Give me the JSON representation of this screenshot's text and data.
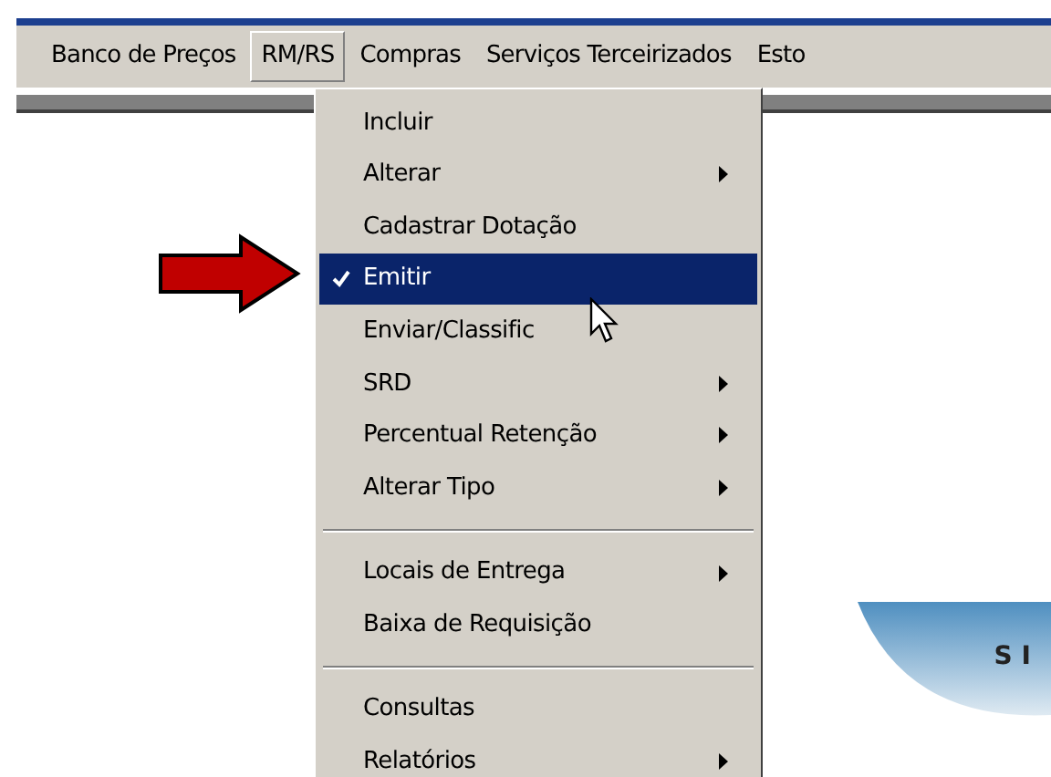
{
  "menubar": [
    {
      "label": "Banco de Preços",
      "selected": false
    },
    {
      "label": "RM/RS",
      "selected": true
    },
    {
      "label": "Compras",
      "selected": false
    },
    {
      "label": "Serviços Terceirizados",
      "selected": false
    },
    {
      "label": "Esto",
      "selected": false
    }
  ],
  "menu": {
    "items": [
      {
        "kind": "item",
        "label": "Incluir",
        "submenu": false,
        "checked": false,
        "selected": false
      },
      {
        "kind": "item",
        "label": "Alterar",
        "submenu": true,
        "checked": false,
        "selected": false
      },
      {
        "kind": "item",
        "label": "Cadastrar Dotação",
        "submenu": false,
        "checked": false,
        "selected": false
      },
      {
        "kind": "item",
        "label": "Emitir",
        "submenu": false,
        "checked": true,
        "selected": true
      },
      {
        "kind": "item",
        "label": "Enviar/Classific",
        "submenu": false,
        "checked": false,
        "selected": false
      },
      {
        "kind": "item",
        "label": "SRD",
        "submenu": true,
        "checked": false,
        "selected": false
      },
      {
        "kind": "item",
        "label": "Percentual Retenção",
        "submenu": true,
        "checked": false,
        "selected": false
      },
      {
        "kind": "item",
        "label": "Alterar Tipo",
        "submenu": true,
        "checked": false,
        "selected": false
      },
      {
        "kind": "separator"
      },
      {
        "kind": "item",
        "label": "Locais de Entrega",
        "submenu": true,
        "checked": false,
        "selected": false
      },
      {
        "kind": "item",
        "label": "Baixa de Requisição",
        "submenu": false,
        "checked": false,
        "selected": false
      },
      {
        "kind": "separator"
      },
      {
        "kind": "item",
        "label": "Consultas",
        "submenu": false,
        "checked": false,
        "selected": false
      },
      {
        "kind": "item",
        "label": "Relatórios",
        "submenu": true,
        "checked": false,
        "selected": false
      }
    ]
  },
  "logo": {
    "text": "SI"
  }
}
